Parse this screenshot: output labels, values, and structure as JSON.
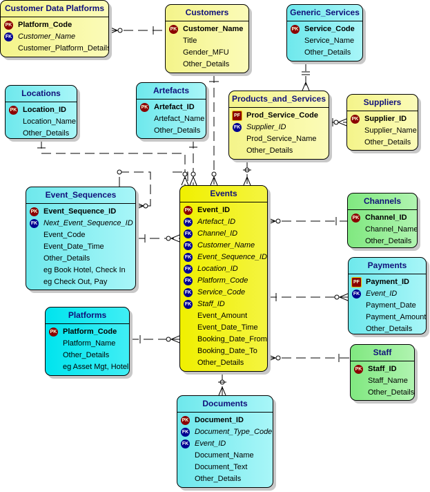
{
  "colors": {
    "title_text": "#10107a",
    "pk_badge": "#8b0000",
    "fk_badge": "#000090",
    "yellow": "#f4f48a",
    "bright_yellow": "#f0f000",
    "cyan": "#6ee8ec",
    "green": "#80e880"
  },
  "entities": [
    {
      "id": "customer-data-platforms",
      "name": "Customer Data Platforms",
      "theme": "yellow",
      "attrs": [
        {
          "key": "PK",
          "text": "Platform_Code"
        },
        {
          "key": "FK",
          "text": "Customer_Name"
        },
        {
          "key": "",
          "text": "Customer_Platform_Details"
        }
      ]
    },
    {
      "id": "customers",
      "name": "Customers",
      "theme": "yellow",
      "attrs": [
        {
          "key": "PK",
          "text": "Customer_Name"
        },
        {
          "key": "",
          "text": "Title"
        },
        {
          "key": "",
          "text": "Gender_MFU"
        },
        {
          "key": "",
          "text": "Other_Details"
        }
      ]
    },
    {
      "id": "generic-services",
      "name": "Generic_Services",
      "theme": "cyan",
      "attrs": [
        {
          "key": "PK",
          "text": "Service_Code"
        },
        {
          "key": "",
          "text": "Service_Name"
        },
        {
          "key": "",
          "text": "Other_Details"
        }
      ]
    },
    {
      "id": "locations",
      "name": "Locations",
      "theme": "cyan",
      "attrs": [
        {
          "key": "PK",
          "text": "Location_ID"
        },
        {
          "key": "",
          "text": "Location_Name"
        },
        {
          "key": "",
          "text": "Other_Details"
        }
      ]
    },
    {
      "id": "artefacts",
      "name": "Artefacts",
      "theme": "cyan",
      "attrs": [
        {
          "key": "PK",
          "text": "Artefact_ID"
        },
        {
          "key": "",
          "text": "Artefact_Name"
        },
        {
          "key": "",
          "text": "Other_Details"
        }
      ]
    },
    {
      "id": "products-and-services",
      "name": "Products_and_Services",
      "theme": "yellow",
      "attrs": [
        {
          "key": "PF",
          "text": "Prod_Service_Code"
        },
        {
          "key": "FK",
          "text": "Supplier_ID"
        },
        {
          "key": "",
          "text": "Prod_Service_Name"
        },
        {
          "key": "",
          "text": "Other_Details"
        }
      ]
    },
    {
      "id": "suppliers",
      "name": "Suppliers",
      "theme": "yellow",
      "attrs": [
        {
          "key": "PK",
          "text": "Supplier_ID"
        },
        {
          "key": "",
          "text": "Supplier_Name"
        },
        {
          "key": "",
          "text": "Other_Details"
        }
      ]
    },
    {
      "id": "event-sequences",
      "name": "Event_Sequences",
      "theme": "cyan",
      "attrs": [
        {
          "key": "PK",
          "text": "Event_Sequence_ID"
        },
        {
          "key": "FK",
          "text": "Next_Event_Sequence_ID"
        },
        {
          "key": "",
          "text": "Event_Code"
        },
        {
          "key": "",
          "text": "Event_Date_Time"
        },
        {
          "key": "",
          "text": "Other_Details"
        },
        {
          "key": "",
          "text": "eg Book Hotel, Check In"
        },
        {
          "key": "",
          "text": "eg Check Out, Pay"
        }
      ]
    },
    {
      "id": "events",
      "name": "Events",
      "theme": "bright",
      "attrs": [
        {
          "key": "PK",
          "text": "Event_ID"
        },
        {
          "key": "FK",
          "text": "Artefact_ID"
        },
        {
          "key": "FK",
          "text": "Channel_ID"
        },
        {
          "key": "FK",
          "text": "Customer_Name"
        },
        {
          "key": "FK",
          "text": "Event_Sequence_ID"
        },
        {
          "key": "FK",
          "text": "Location_ID"
        },
        {
          "key": "FK",
          "text": "Platform_Code"
        },
        {
          "key": "FK",
          "text": "Service_Code"
        },
        {
          "key": "FK",
          "text": "Staff_ID"
        },
        {
          "key": "",
          "text": "Event_Amount"
        },
        {
          "key": "",
          "text": "Event_Date_Time"
        },
        {
          "key": "",
          "text": "Booking_Date_From"
        },
        {
          "key": "",
          "text": "Booking_Date_To"
        },
        {
          "key": "",
          "text": "Other_Details"
        }
      ]
    },
    {
      "id": "channels",
      "name": "Channels",
      "theme": "green",
      "attrs": [
        {
          "key": "PK",
          "text": "Channel_ID"
        },
        {
          "key": "",
          "text": "Channel_Name"
        },
        {
          "key": "",
          "text": "Other_Details"
        }
      ]
    },
    {
      "id": "payments",
      "name": "Payments",
      "theme": "cyan",
      "attrs": [
        {
          "key": "PF",
          "text": "Payment_ID"
        },
        {
          "key": "FK",
          "text": "Event_ID"
        },
        {
          "key": "",
          "text": "Payment_Date"
        },
        {
          "key": "",
          "text": "Payment_Amount"
        },
        {
          "key": "",
          "text": "Other_Details"
        }
      ]
    },
    {
      "id": "platforms",
      "name": "Platforms",
      "theme": "cyan2",
      "attrs": [
        {
          "key": "PK",
          "text": "Platform_Code"
        },
        {
          "key": "",
          "text": "Platform_Name"
        },
        {
          "key": "",
          "text": "Other_Details"
        },
        {
          "key": "",
          "text": "eg Asset Mgt, Hotel"
        }
      ]
    },
    {
      "id": "staff",
      "name": "Staff",
      "theme": "green",
      "attrs": [
        {
          "key": "PK",
          "text": "Staff_ID"
        },
        {
          "key": "",
          "text": "Staff_Name"
        },
        {
          "key": "",
          "text": "Other_Details"
        }
      ]
    },
    {
      "id": "documents",
      "name": "Documents",
      "theme": "cyan",
      "attrs": [
        {
          "key": "PK",
          "text": "Document_ID"
        },
        {
          "key": "FK",
          "text": "Document_Type_Code"
        },
        {
          "key": "FK",
          "text": "Event_ID"
        },
        {
          "key": "",
          "text": "Document_Name"
        },
        {
          "key": "",
          "text": "Document_Text"
        },
        {
          "key": "",
          "text": "Other_Details"
        }
      ]
    }
  ]
}
